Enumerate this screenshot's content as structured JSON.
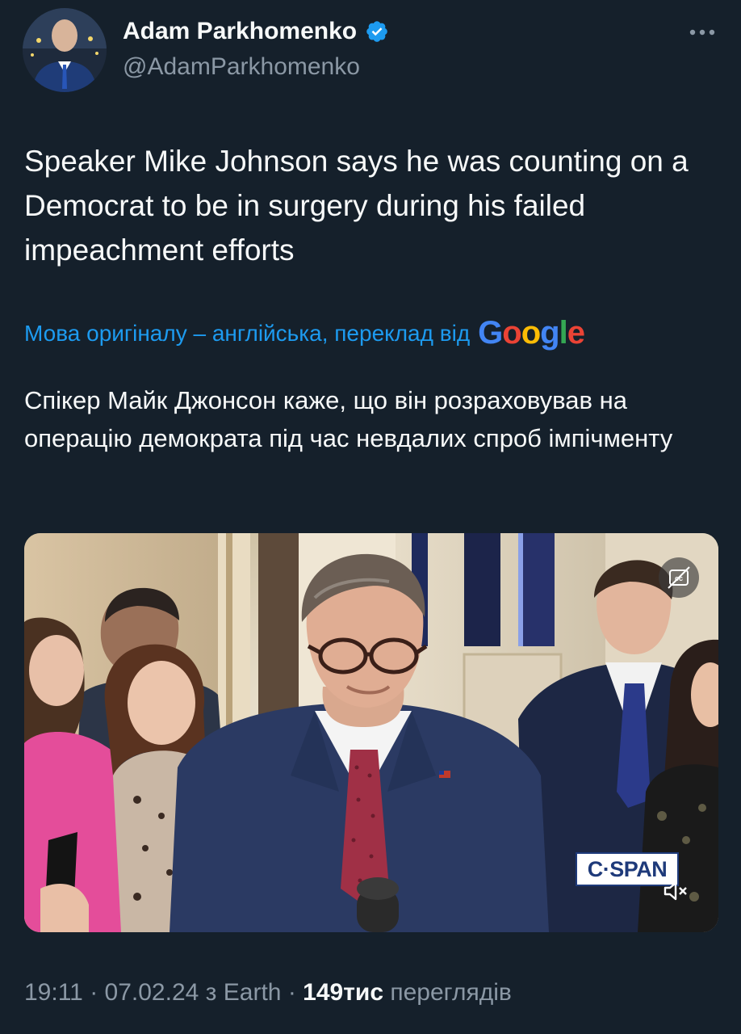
{
  "author": {
    "display_name": "Adam Parkhomenko",
    "handle": "@AdamParkhomenko",
    "verified_icon": "verified-badge-icon",
    "avatar_icon": "profile-avatar"
  },
  "more_icon": "more-horizontal-icon",
  "tweet": {
    "text": "Speaker Mike Johnson says he was counting on a Democrat to be in surgery during his failed impeachment efforts"
  },
  "translation": {
    "label": "Мова оригіналу – англійська, переклад від",
    "provider": [
      "G",
      "o",
      "o",
      "g",
      "l",
      "e"
    ],
    "translated_text": "Спікер Майк Джонсон каже, що він розраховував на операцію демократа під час невдалих спроб імпічменту"
  },
  "media": {
    "captions_icon": "captions-off-icon",
    "watermark": "C·SPAN",
    "mute_icon": "volume-muted-icon"
  },
  "meta": {
    "time": "19:11",
    "date": "07.02.24",
    "source": "з Earth",
    "sep": "·",
    "views": "149тис",
    "views_label": "переглядів"
  },
  "colors": {
    "background": "#15202b",
    "text": "#f7f9f9",
    "secondary": "#8b98a5",
    "link": "#1d9bf0",
    "verified": "#1d9bf0"
  }
}
